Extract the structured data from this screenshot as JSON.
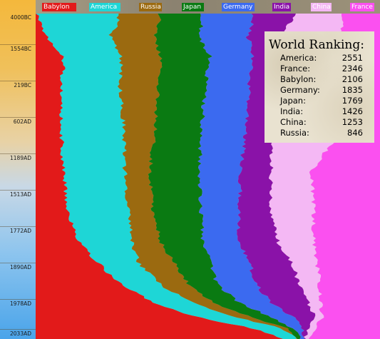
{
  "legend": [
    {
      "name": "Babylon",
      "color": "#e21a1a"
    },
    {
      "name": "America",
      "color": "#1ed6d6"
    },
    {
      "name": "Russia",
      "color": "#9b6a10"
    },
    {
      "name": "Japan",
      "color": "#0a7a12"
    },
    {
      "name": "Germany",
      "color": "#3b6af0"
    },
    {
      "name": "India",
      "color": "#8a12a8"
    },
    {
      "name": "China",
      "color": "#f4b8f4"
    },
    {
      "name": "France",
      "color": "#fb50f0"
    }
  ],
  "timeline": [
    "4000BC",
    "1554BC",
    "219BC",
    "602AD",
    "1189AD",
    "1513AD",
    "1772AD",
    "1890AD",
    "1978AD",
    "2033AD"
  ],
  "ranking": {
    "title": "World Ranking:",
    "rows": [
      {
        "name": "America:",
        "score": "2551"
      },
      {
        "name": "France:",
        "score": "2346"
      },
      {
        "name": "Babylon:",
        "score": "2106"
      },
      {
        "name": "Germany:",
        "score": "1835"
      },
      {
        "name": "Japan:",
        "score": "1769"
      },
      {
        "name": "India:",
        "score": "1426"
      },
      {
        "name": "China:",
        "score": "1253"
      },
      {
        "name": "Russia:",
        "score": "846"
      }
    ]
  }
}
